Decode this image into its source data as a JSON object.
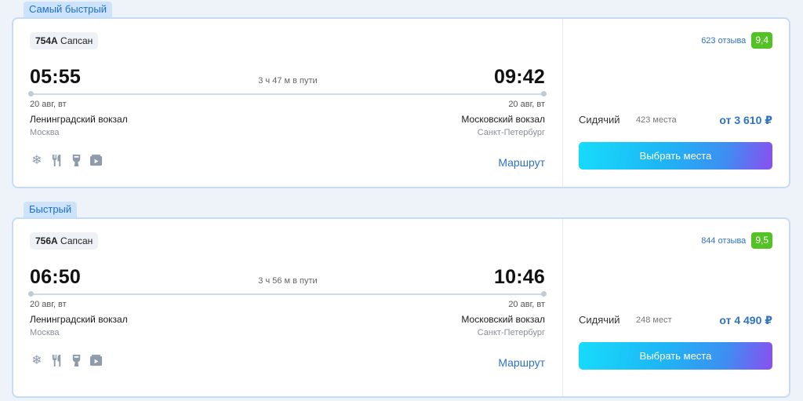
{
  "offers": [
    {
      "badge": "Самый быстрый",
      "train_number": "754А",
      "train_name": "Сапсан",
      "departure_time": "05:55",
      "arrival_time": "09:42",
      "duration": "3 ч 47 м в пути",
      "departure_date": "20 авг, вт",
      "arrival_date": "20 авг, вт",
      "departure_station": "Ленинградский вокзал",
      "arrival_station": "Московский вокзал",
      "departure_city": "Москва",
      "arrival_city": "Санкт-Петербург",
      "route_link": "Маршрут",
      "reviews_count": "623 отзыва",
      "rating": "9,4",
      "seat_type": "Сидячий",
      "seats_available": "423 места",
      "price": "от 3 610 ₽",
      "select_button": "Выбрать места"
    },
    {
      "badge": "Быстрый",
      "train_number": "756А",
      "train_name": "Сапсан",
      "departure_time": "06:50",
      "arrival_time": "10:46",
      "duration": "3 ч 56 м в пути",
      "departure_date": "20 авг, вт",
      "arrival_date": "20 авг, вт",
      "departure_station": "Ленинградский вокзал",
      "arrival_station": "Московский вокзал",
      "departure_city": "Москва",
      "arrival_city": "Санкт-Петербург",
      "route_link": "Маршрут",
      "reviews_count": "844 отзыва",
      "rating": "9,5",
      "seat_type": "Сидячий",
      "seats_available": "248 мест",
      "price": "от 4 490 ₽",
      "select_button": "Выбрать места"
    }
  ],
  "amenity_icons": [
    "snowflake-icon",
    "fork-knife-icon",
    "toilet-icon",
    "media-icon"
  ],
  "colors": {
    "accent": "#2e73c7",
    "rating_green": "#52c224",
    "badge_bg": "#cde3fb",
    "button_gradient_start": "#16dcfb",
    "button_gradient_end": "#8a4ff0"
  }
}
